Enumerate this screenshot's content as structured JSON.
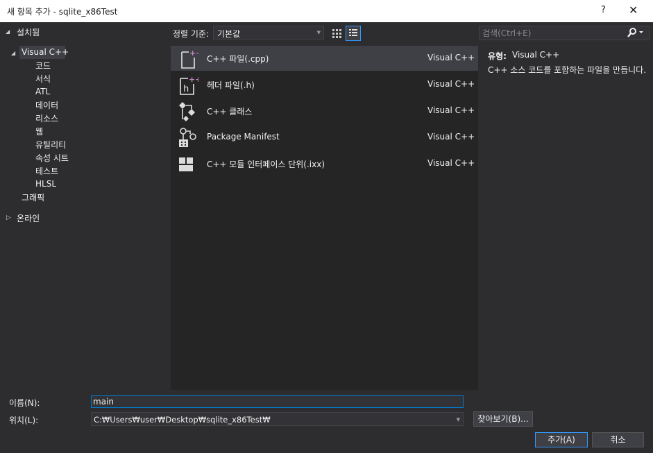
{
  "window": {
    "title": "새 항목 추가 - sqlite_x86Test",
    "help": "?",
    "close": "✕"
  },
  "tree": {
    "installed": "설치됨",
    "visual_cpp": "Visual C++",
    "children": [
      "코드",
      "서식",
      "ATL",
      "데이터",
      "리소스",
      "웹",
      "유틸리티",
      "속성 시트",
      "테스트",
      "HLSL"
    ],
    "graphics": "그래픽",
    "online": "온라인"
  },
  "toolbar": {
    "sort_label": "정렬 기준:",
    "sort_value": "기본값",
    "search_placeholder": "검색(Ctrl+E)"
  },
  "templates": [
    {
      "name": "C++ 파일(.cpp)",
      "lang": "Visual C++",
      "icon": "cpp-file-icon"
    },
    {
      "name": "헤더 파일(.h)",
      "lang": "Visual C++",
      "icon": "header-file-icon"
    },
    {
      "name": "C++ 클래스",
      "lang": "Visual C++",
      "icon": "cpp-class-icon"
    },
    {
      "name": "Package Manifest",
      "lang": "Visual C++",
      "icon": "package-manifest-icon"
    },
    {
      "name": "C++ 모듈 인터페이스 단위(.ixx)",
      "lang": "Visual C++",
      "icon": "module-interface-icon"
    }
  ],
  "details": {
    "type_label": "유형:",
    "type_value": "Visual C++",
    "description": "C++ 소스 코드를 포함하는 파일을 만듭니다."
  },
  "form": {
    "name_label": "이름(N):",
    "name_value": "main",
    "location_label": "위치(L):",
    "location_value": "C:₩Users₩user₩Desktop₩sqlite_x86Test₩",
    "browse_label": "찾아보기(B)...",
    "add_label": "추가(A)",
    "cancel_label": "취소"
  },
  "colors": {
    "accent": "#007acc",
    "cpp_plus": "#c586c0",
    "background": "#2d2d30",
    "list_background": "#252526"
  }
}
